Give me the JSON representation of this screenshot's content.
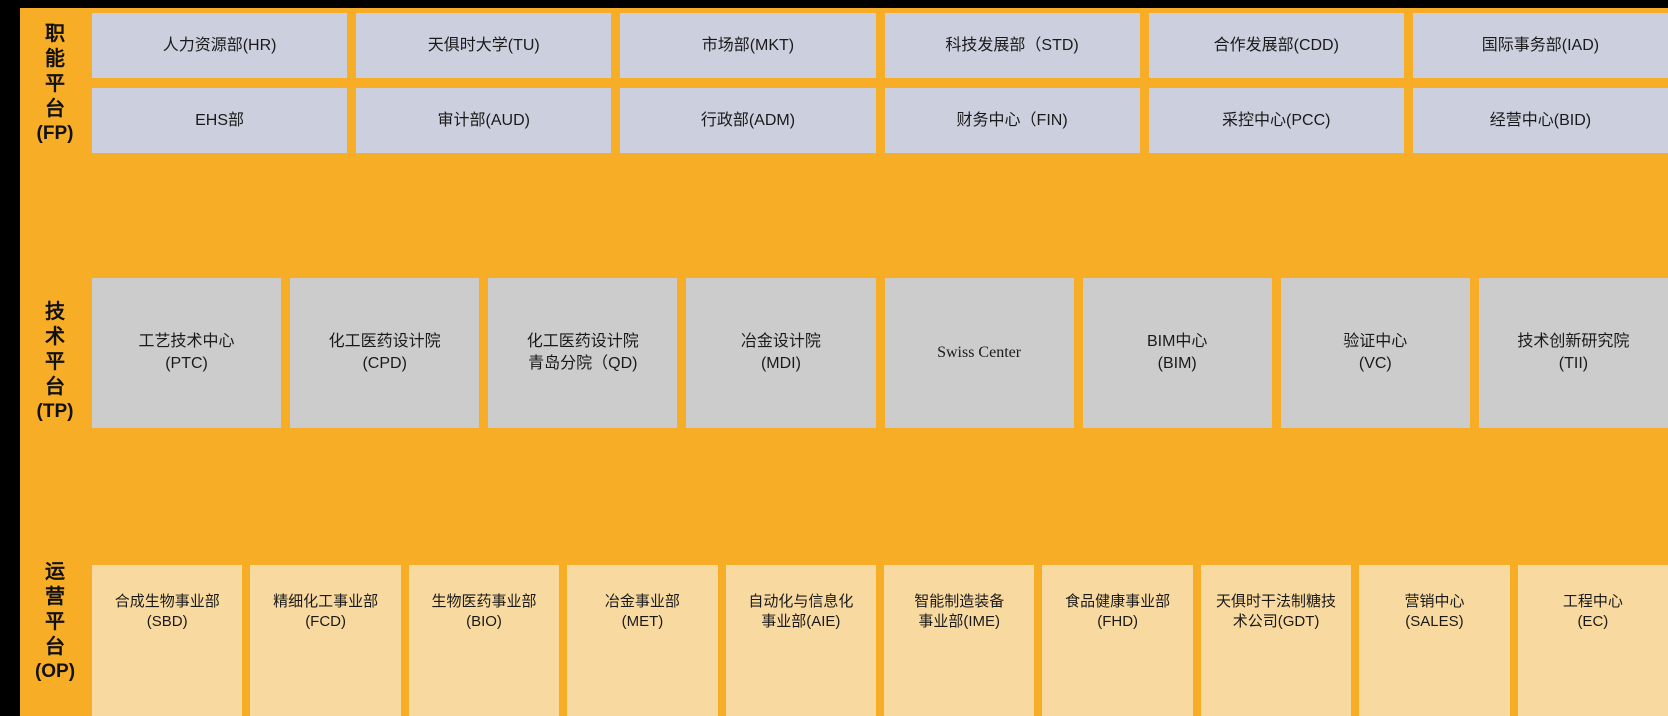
{
  "colors": {
    "panel_orange": "#f7ad26",
    "fp_box": "#ccd0de",
    "tp_box": "#cccccc",
    "op_box": "#f8d9a0",
    "border_black": "#000000",
    "text": "#1a1a1a"
  },
  "platforms": [
    {
      "id": "FP",
      "label_chars": [
        "职",
        "能",
        "平",
        "台"
      ],
      "label_abbr": "(FP)",
      "label_full": "职能平台(FP)",
      "rows": [
        {
          "cells": [
            {
              "label": "人力资源部(HR)"
            },
            {
              "label": "天俱时大学(TU)"
            },
            {
              "label": "市场部(MKT)"
            },
            {
              "label": "科技发展部（STD)"
            },
            {
              "label": "合作发展部(CDD)"
            },
            {
              "label": "国际事务部(IAD)"
            }
          ]
        },
        {
          "cells": [
            {
              "label": "EHS部"
            },
            {
              "label": "审计部(AUD)"
            },
            {
              "label": "行政部(ADM)"
            },
            {
              "label": "财务中心（FIN)"
            },
            {
              "label": "采控中心(PCC)"
            },
            {
              "label": "经营中心(BID)"
            }
          ]
        }
      ]
    },
    {
      "id": "TP",
      "label_chars": [
        "技",
        "术",
        "平",
        "台"
      ],
      "label_abbr": "(TP)",
      "label_full": "技术平台(TP)",
      "rows": [
        {
          "cells": [
            {
              "label": "工艺技术中心\n(PTC)"
            },
            {
              "label": "化工医药设计院\n(CPD)"
            },
            {
              "label": "化工医药设计院\n青岛分院（QD)"
            },
            {
              "label": "冶金设计院\n(MDI)"
            },
            {
              "label": "Swiss Center",
              "serif": true
            },
            {
              "label": "BIM中心\n(BIM)"
            },
            {
              "label": "验证中心\n(VC)"
            },
            {
              "label": "技术创新研究院\n(TII)"
            }
          ]
        }
      ]
    },
    {
      "id": "OP",
      "label_chars": [
        "运",
        "营",
        "平",
        "台"
      ],
      "label_abbr": "(OP)",
      "label_full": "运营平台(OP)",
      "rows": [
        {
          "cells": [
            {
              "label": "合成生物事业部\n(SBD)"
            },
            {
              "label": "精细化工事业部\n(FCD)"
            },
            {
              "label": "生物医药事业部\n(BIO)"
            },
            {
              "label": "冶金事业部\n(MET)"
            },
            {
              "label": "自动化与信息化\n事业部(AIE)"
            },
            {
              "label": "智能制造装备\n事业部(IME)"
            },
            {
              "label": "食品健康事业部\n(FHD)"
            },
            {
              "label": "天俱时干法制糖技\n术公司(GDT)"
            },
            {
              "label": "营销中心\n(SALES)"
            },
            {
              "label": "工程中心\n(EC)"
            }
          ]
        }
      ]
    }
  ]
}
